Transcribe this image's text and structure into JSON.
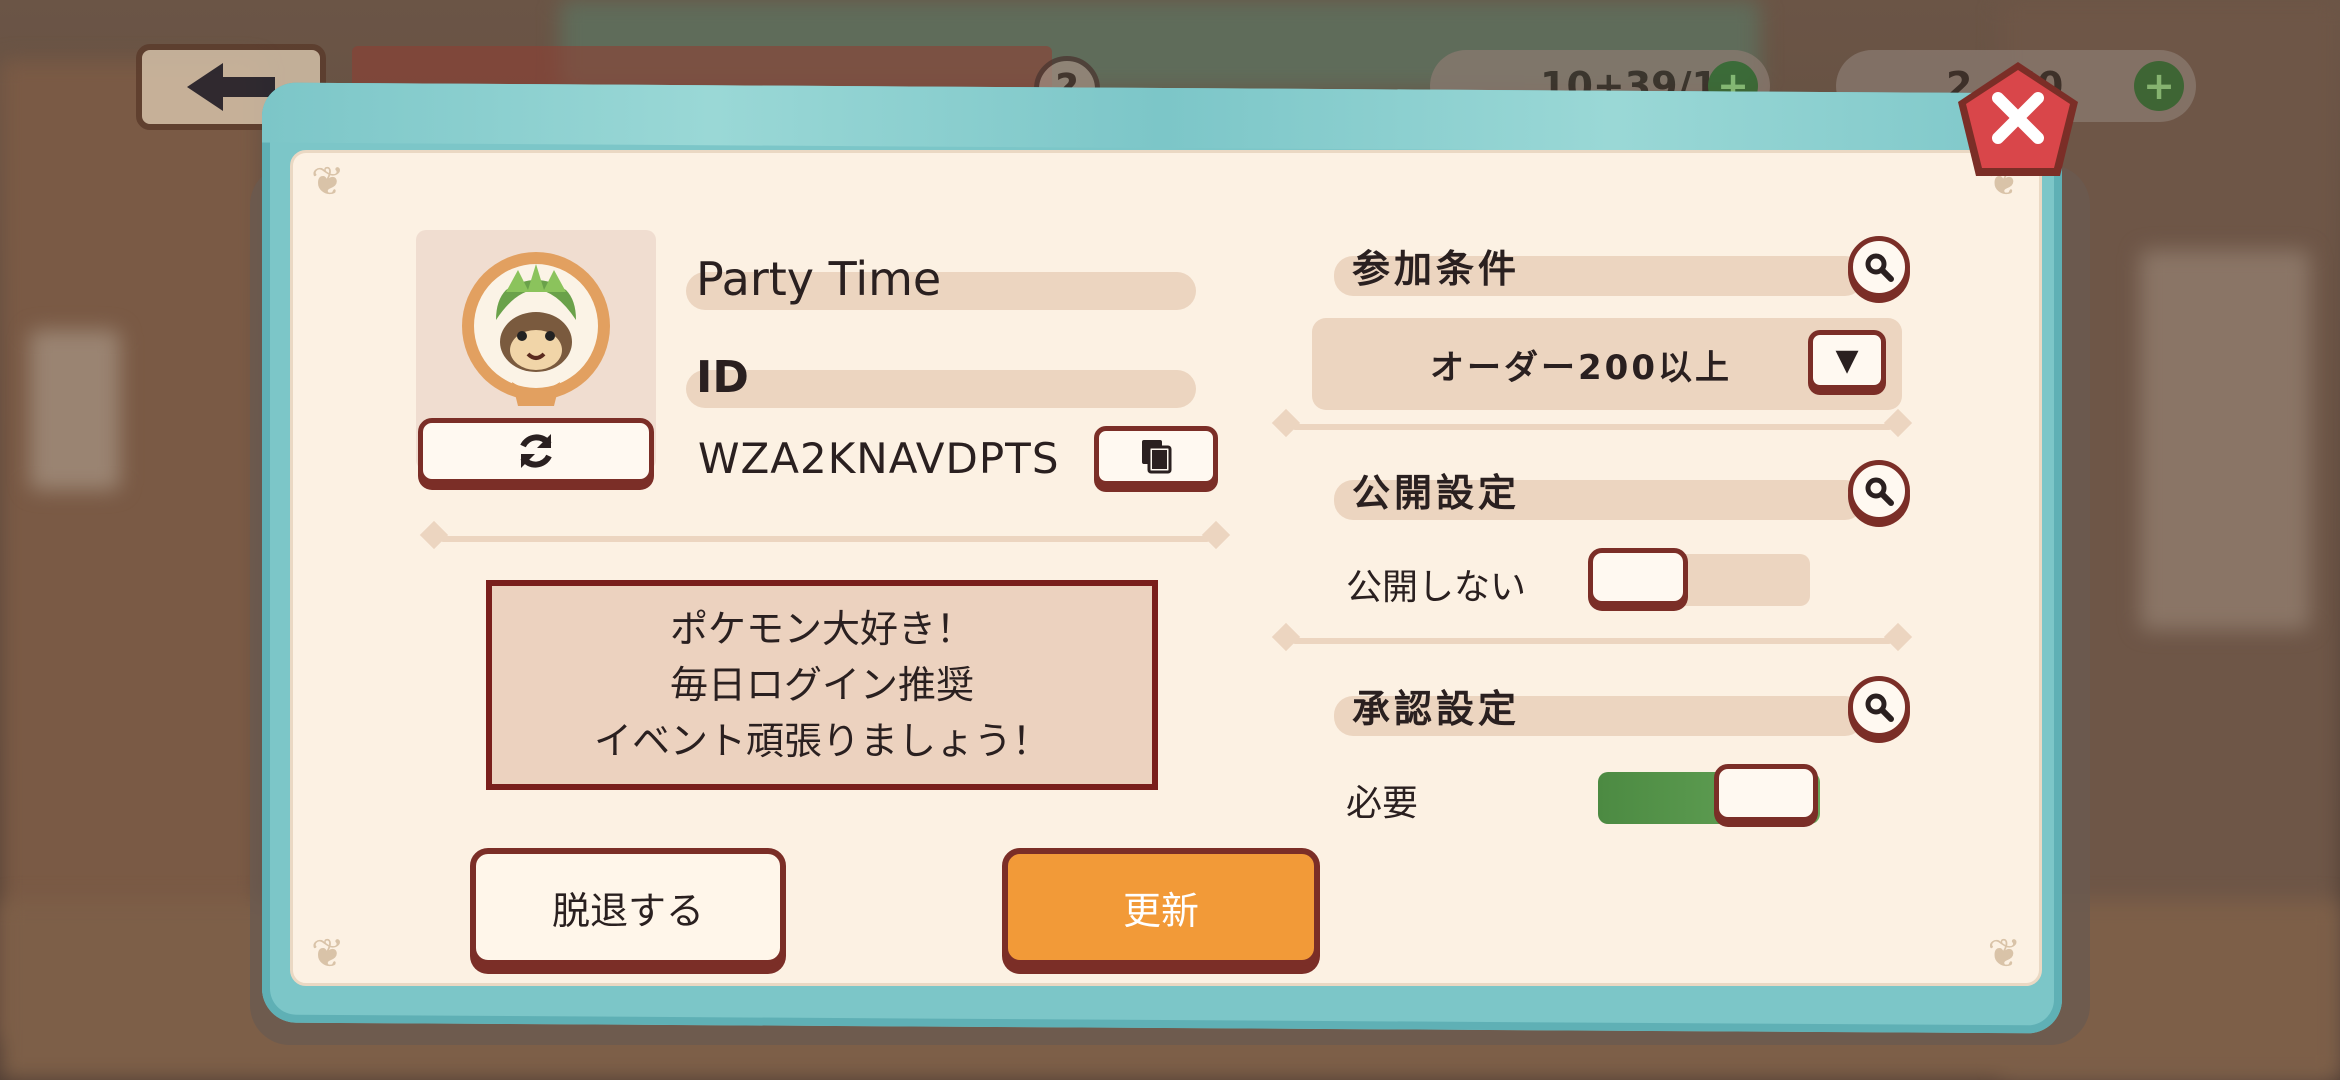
{
  "top_bar": {
    "help_label": "?",
    "resource1": {
      "value": "10+39/10",
      "plus": "+"
    },
    "resource2": {
      "value": "2…50",
      "plus": "+"
    }
  },
  "dialog": {
    "close_icon": "close-x",
    "profile": {
      "party_name": "Party Time",
      "id_label": "ID",
      "id_value": "WZA2KNAVDPTS",
      "avatar_icon": "chespin-avatar",
      "refresh_icon": "refresh-arrows",
      "copy_icon": "copy-documents"
    },
    "message_lines": [
      "ポケモン大好き！",
      "毎日ログイン推奨",
      "イベント頑張りましょう！"
    ],
    "buttons": {
      "leave": "脱退する",
      "update": "更新"
    },
    "conditions": {
      "title": "参加条件",
      "selected": "オーダー200以上",
      "dropdown_arrow": "▼"
    },
    "visibility": {
      "title": "公開設定",
      "value_label": "公開しない",
      "enabled": false
    },
    "approval": {
      "title": "承認設定",
      "value_label": "必要",
      "enabled": true
    },
    "colors": {
      "frame": "#7cc6c8",
      "panel": "#fcf1e3",
      "accent_orange": "#f29a38",
      "border_brown": "#7b2e27",
      "toggle_on": "#5a9a4e",
      "close_red": "#d9464a"
    }
  }
}
